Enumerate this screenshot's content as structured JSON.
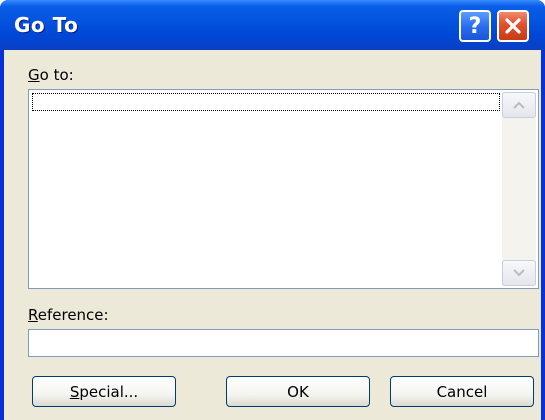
{
  "window": {
    "title": "Go To"
  },
  "titlebar": {
    "help_glyph": "?",
    "help_icon": "help-icon",
    "close_icon": "close-icon"
  },
  "goto": {
    "label_accel": "G",
    "label_rest": "o to:",
    "items": []
  },
  "listbox": {
    "scroll_up_icon": "chevron-up-icon",
    "scroll_down_icon": "chevron-down-icon"
  },
  "reference": {
    "label_accel": "R",
    "label_rest": "eference:",
    "value": ""
  },
  "buttons": {
    "special_accel": "S",
    "special_rest": "pecial...",
    "ok_label": "OK",
    "cancel_label": "Cancel"
  }
}
